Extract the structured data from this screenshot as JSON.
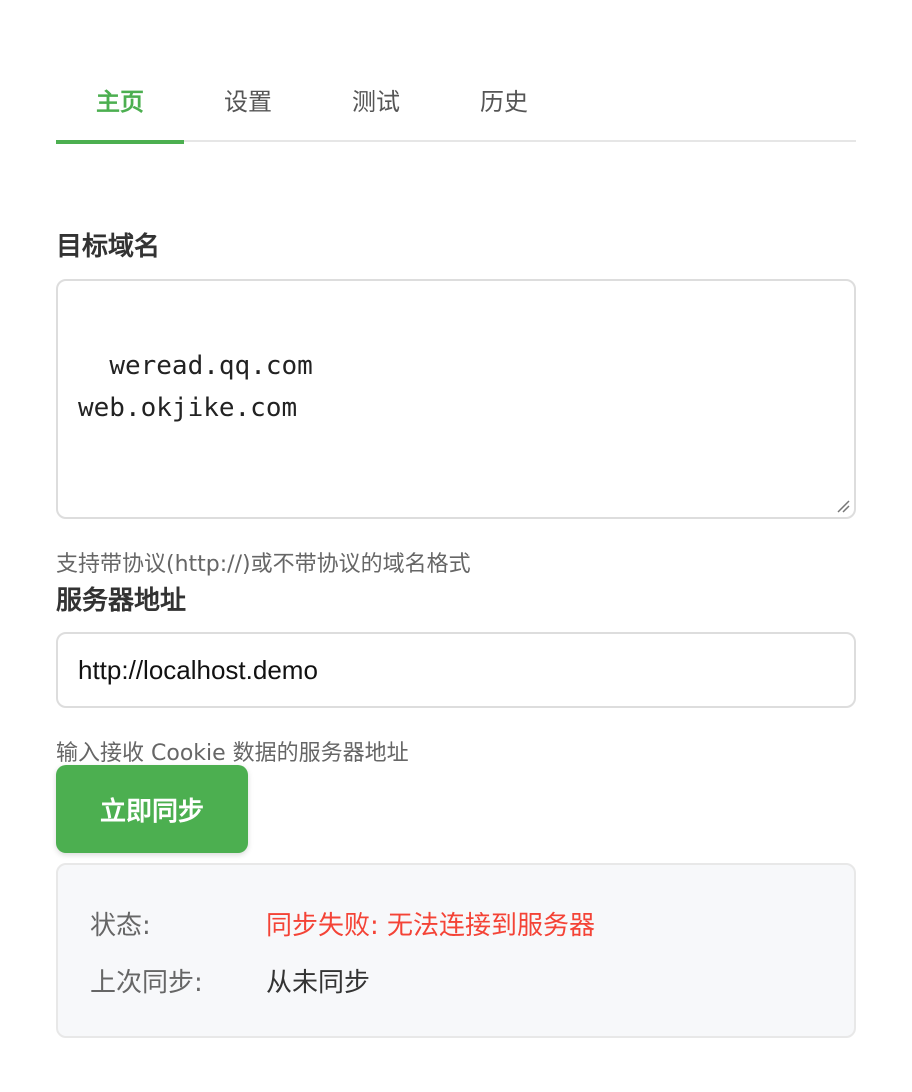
{
  "tabs": [
    {
      "label": "主页",
      "active": true
    },
    {
      "label": "设置",
      "active": false
    },
    {
      "label": "测试",
      "active": false
    },
    {
      "label": "历史",
      "active": false
    }
  ],
  "domain_field": {
    "label": "目标域名",
    "value": "weread.qq.com\nweb.okjike.com",
    "help": "支持带协议(http://)或不带协议的域名格式"
  },
  "server_field": {
    "label": "服务器地址",
    "value": "http://localhost.demo",
    "help": "输入接收 Cookie 数据的服务器地址"
  },
  "sync_button": {
    "label": "立即同步"
  },
  "status": {
    "state_key": "状态:",
    "state_value": "同步失败: 无法连接到服务器",
    "last_key": "上次同步:",
    "last_value": "从未同步"
  },
  "colors": {
    "accent": "#4caf50",
    "error": "#f44336"
  }
}
